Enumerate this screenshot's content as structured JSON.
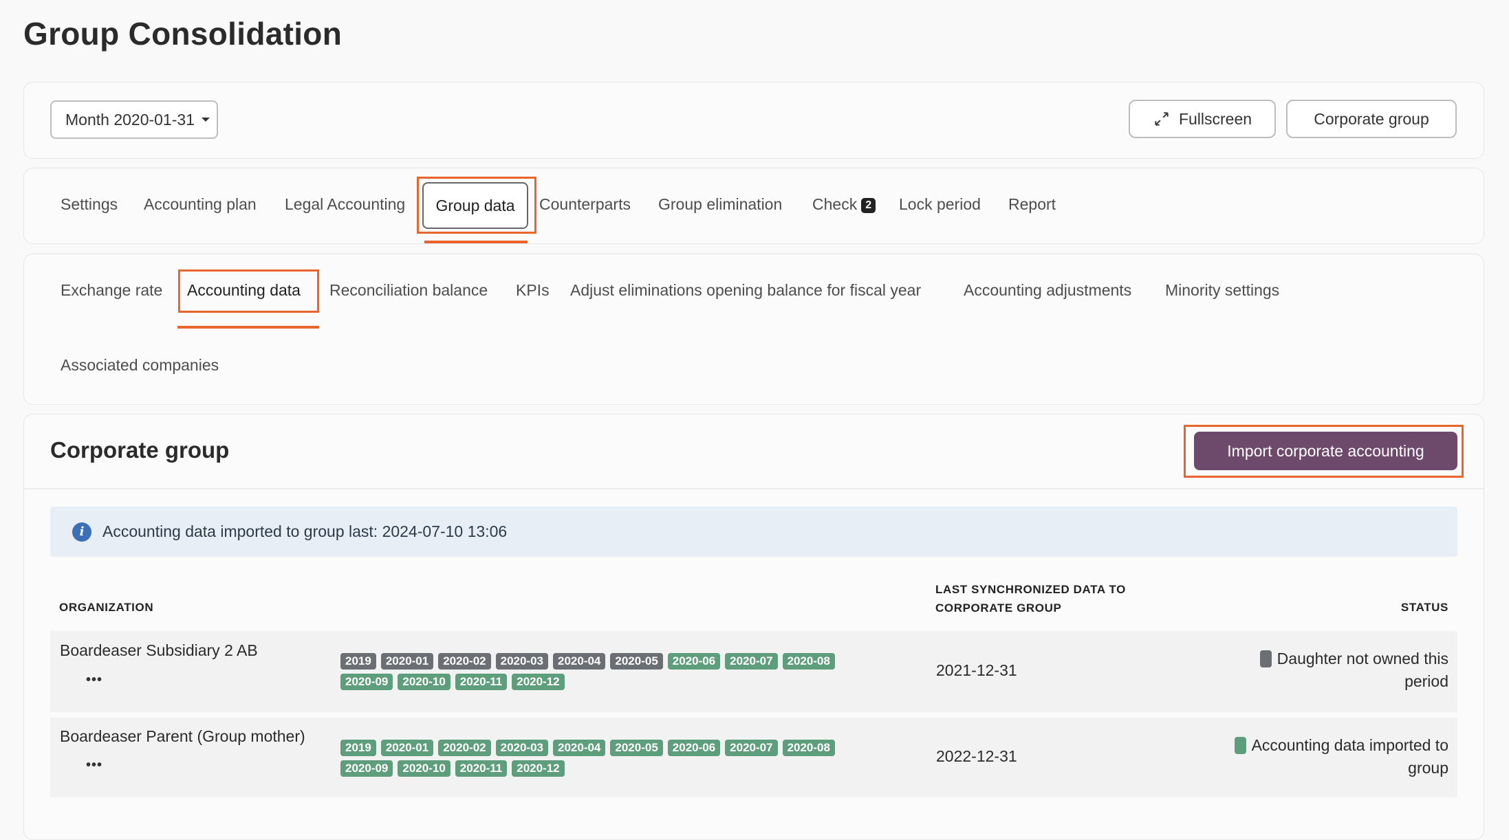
{
  "page_title": "Group Consolidation",
  "toolbar": {
    "month_select": "Month 2020-01-31",
    "fullscreen_label": "Fullscreen",
    "corporate_group_label": "Corporate group"
  },
  "main_tabs": [
    {
      "label": "Settings"
    },
    {
      "label": "Accounting plan"
    },
    {
      "label": "Legal Accounting"
    },
    {
      "label": "Group data"
    },
    {
      "label": "Counterparts"
    },
    {
      "label": "Group elimination"
    },
    {
      "label": "Check",
      "badge": "2"
    },
    {
      "label": "Lock period"
    },
    {
      "label": "Report"
    }
  ],
  "sub_tabs": [
    {
      "label": "Exchange rate"
    },
    {
      "label": "Accounting data"
    },
    {
      "label": "Reconciliation balance"
    },
    {
      "label": "KPIs"
    },
    {
      "label": "Adjust eliminations opening balance for fiscal year"
    },
    {
      "label": "Accounting adjustments"
    },
    {
      "label": "Minority settings"
    },
    {
      "label": "Associated companies"
    }
  ],
  "section": {
    "title": "Corporate group",
    "import_button": "Import corporate accounting"
  },
  "info": {
    "text": "Accounting data imported to group last: 2024-07-10 13:06"
  },
  "table": {
    "headers": {
      "organization": "ORGANIZATION",
      "last_sync_line1": "LAST SYNCHRONIZED DATA TO",
      "last_sync_line2": "CORPORATE GROUP",
      "status": "STATUS"
    },
    "rows": [
      {
        "organization": "Boardeaser Subsidiary 2 AB",
        "more": "•••",
        "periods": [
          {
            "label": "2019",
            "state": "grey"
          },
          {
            "label": "2020-01",
            "state": "grey"
          },
          {
            "label": "2020-02",
            "state": "grey"
          },
          {
            "label": "2020-03",
            "state": "grey"
          },
          {
            "label": "2020-04",
            "state": "grey"
          },
          {
            "label": "2020-05",
            "state": "grey"
          },
          {
            "label": "2020-06",
            "state": "green"
          },
          {
            "label": "2020-07",
            "state": "green"
          },
          {
            "label": "2020-08",
            "state": "green"
          },
          {
            "label": "2020-09",
            "state": "green"
          },
          {
            "label": "2020-10",
            "state": "green"
          },
          {
            "label": "2020-11",
            "state": "green"
          },
          {
            "label": "2020-12",
            "state": "green"
          }
        ],
        "last_sync": "2021-12-31",
        "status_line1": "Daughter not owned this",
        "status_line2": "period",
        "status_color": "#6b6e72"
      },
      {
        "organization": "Boardeaser Parent (Group mother)",
        "more": "•••",
        "periods": [
          {
            "label": "2019",
            "state": "green"
          },
          {
            "label": "2020-01",
            "state": "green"
          },
          {
            "label": "2020-02",
            "state": "green"
          },
          {
            "label": "2020-03",
            "state": "green"
          },
          {
            "label": "2020-04",
            "state": "green"
          },
          {
            "label": "2020-05",
            "state": "green"
          },
          {
            "label": "2020-06",
            "state": "green"
          },
          {
            "label": "2020-07",
            "state": "green"
          },
          {
            "label": "2020-08",
            "state": "green"
          },
          {
            "label": "2020-09",
            "state": "green"
          },
          {
            "label": "2020-10",
            "state": "green"
          },
          {
            "label": "2020-11",
            "state": "green"
          },
          {
            "label": "2020-12",
            "state": "green"
          }
        ],
        "last_sync": "2022-12-31",
        "status_line1": "Accounting data imported to",
        "status_line2": "group",
        "status_color": "#5f9e7c"
      }
    ]
  },
  "colors": {
    "accent_orange": "#e8662b",
    "primary_button": "#6d4a6b",
    "tag_grey": "#6b6e72",
    "tag_green": "#5f9e7c",
    "info_bg": "#e8eef5"
  },
  "icons": {
    "fullscreen": "expand-arrows-icon",
    "info": "info-circle-icon"
  }
}
